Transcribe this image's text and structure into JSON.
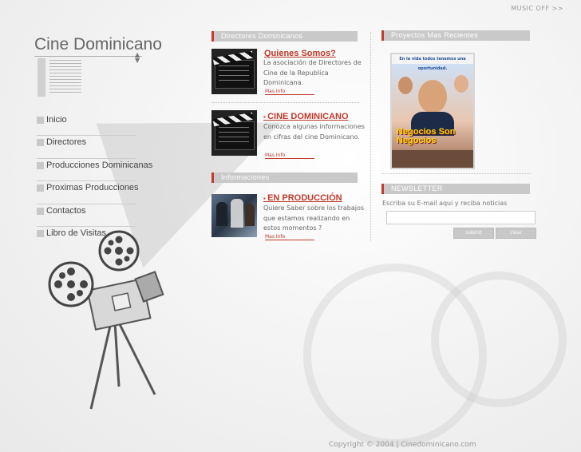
{
  "header": {
    "music_toggle": "MUSIC OFF >>"
  },
  "logo": {
    "title": "Cine Dominicano"
  },
  "nav": {
    "items": [
      {
        "label": "Inicio"
      },
      {
        "label": "Directores"
      },
      {
        "label": "Producciones Dominicanas"
      },
      {
        "label": "Proximas Producciones"
      },
      {
        "label": "Contactos"
      },
      {
        "label": "Libro de Visitas"
      }
    ]
  },
  "directores": {
    "heading": "Directores Dominicanos",
    "entries": [
      {
        "title": "Quienes Somos?",
        "body_lines": [
          "La asociación de Directores de",
          "Cine de la Republica",
          "Dominicana."
        ],
        "more": "Mas Info"
      },
      {
        "title": "CINE DOMINICANO",
        "body_lines": [
          "Conozca algunas informaciones",
          "en cifras del cine Dominicano."
        ],
        "more": "Mas Info"
      }
    ]
  },
  "informaciones": {
    "heading": "Informaciones",
    "entry": {
      "title": "EN PRODUCCIÓN",
      "body_lines": [
        "Quiere Saber sobre los trabajos",
        "que estamos realizando en",
        "estos momentos ?"
      ],
      "more": "Mas Info"
    }
  },
  "proyectos": {
    "heading": "Proyectos Mas Recientes",
    "poster": {
      "tagline": "En la vida todos tenemos una oportunidad.",
      "title_line1": "Negocios Son",
      "title_line2": "Negocios"
    }
  },
  "newsletter": {
    "heading": "NEWSLETTER",
    "label": "Escriba su E-mail aqui y reciba noticias",
    "input_value": "",
    "submit": "submit",
    "clear": "clear"
  },
  "footer": {
    "copyright": "Copyright © 2004 | Cinedominicano.com"
  },
  "colors": {
    "accent": "#c0392b",
    "section_bar": "#c9c9c9"
  }
}
